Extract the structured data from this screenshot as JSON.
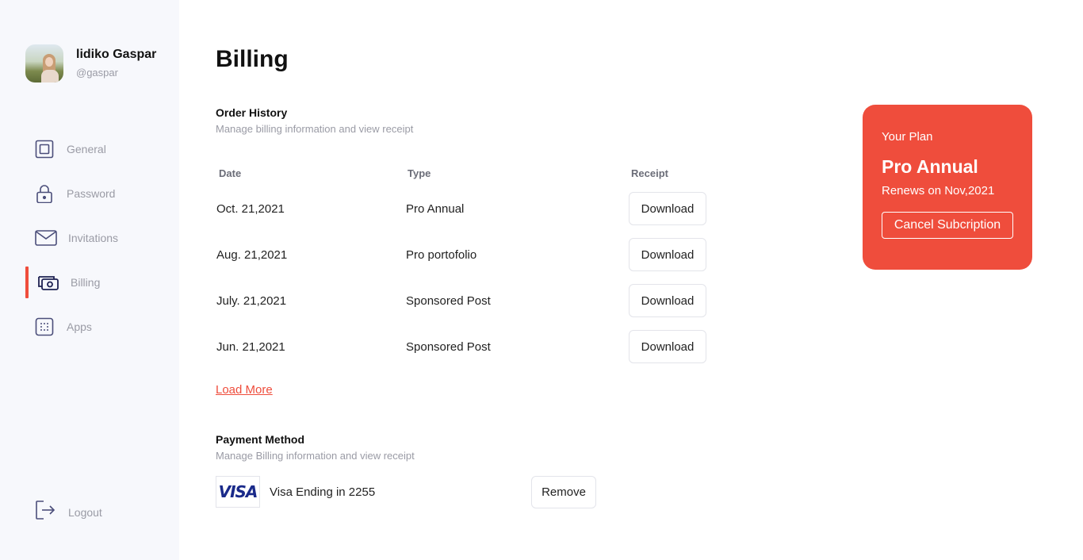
{
  "user": {
    "name": "lidiko Gaspar",
    "handle": "@gaspar"
  },
  "nav": {
    "items": [
      {
        "label": "General",
        "icon": "square-icon"
      },
      {
        "label": "Password",
        "icon": "lock-icon"
      },
      {
        "label": "Invitations",
        "icon": "mail-icon"
      },
      {
        "label": "Billing",
        "icon": "money-icon",
        "active": true
      },
      {
        "label": "Apps",
        "icon": "grid-icon"
      }
    ],
    "logout": "Logout"
  },
  "page": {
    "title": "Billing"
  },
  "order_history": {
    "title": "Order History",
    "subtitle": "Manage billing information and view receipt",
    "columns": [
      "Date",
      "Type",
      "Receipt"
    ],
    "rows": [
      {
        "date": "Oct. 21,2021",
        "type": "Pro Annual",
        "action": "Download"
      },
      {
        "date": "Aug. 21,2021",
        "type": "Pro portofolio",
        "action": "Download"
      },
      {
        "date": "July. 21,2021",
        "type": "Sponsored Post",
        "action": "Download"
      },
      {
        "date": "Jun. 21,2021",
        "type": "Sponsored Post",
        "action": "Download"
      }
    ],
    "load_more": "Load More"
  },
  "payment": {
    "title": "Payment Method",
    "subtitle": "Manage Billing information and view receipt",
    "card_brand": "VISA",
    "card_text": "Visa Ending in 2255",
    "remove_label": "Remove"
  },
  "plan": {
    "label": "Your Plan",
    "name": "Pro Annual",
    "renews": "Renews on Nov,2021",
    "cancel_label": "Cancel Subcription"
  },
  "colors": {
    "accent": "#ef4d3c",
    "sidebar_bg": "#f7f8fc",
    "icon": "#4b4e7a"
  }
}
